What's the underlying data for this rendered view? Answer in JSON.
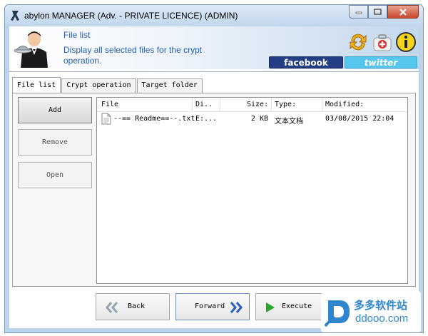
{
  "window": {
    "title": "abylon MANAGER (Adv. - PRIVATE LICENCE) (ADMIN)"
  },
  "header": {
    "title": "File list",
    "description": "Display all selected files for the crypt operation.",
    "facebook_label": "facebook",
    "twitter_label": "twitter"
  },
  "tabs": [
    {
      "label": "File list",
      "active": true
    },
    {
      "label": "Crypt operation",
      "active": false
    },
    {
      "label": "Target folder",
      "active": false
    }
  ],
  "side_buttons": {
    "add": "Add",
    "remove": "Remove",
    "open": "Open"
  },
  "file_list": {
    "columns": [
      "File",
      "Di...",
      "Size:",
      "Type:",
      "Modified:"
    ],
    "rows": [
      {
        "file": "--== Readme==--.txt",
        "dir": "E:...",
        "size": "2 KB",
        "type": "文本文档",
        "modified": "03/08/2015 22:04"
      }
    ]
  },
  "nav": {
    "back": "Back",
    "forward": "Forward",
    "execute": "Execute"
  },
  "watermark": {
    "brand": "多多软件站",
    "domain": "ddooo.com"
  },
  "colors": {
    "accent_text": "#2a5fb0",
    "facebook": "#243e85",
    "twitter": "#55c6ed",
    "execute_arrow": "#2aa52a",
    "nav_arrows": "#2a5fc8"
  }
}
